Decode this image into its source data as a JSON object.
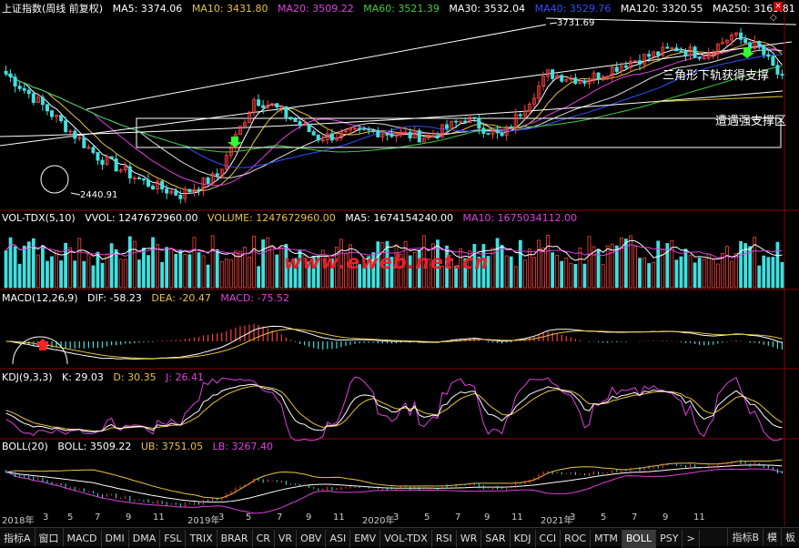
{
  "main": {
    "title": "上证指数(周线 前复权)",
    "ma": [
      {
        "label": "MA5: 3374.06",
        "color": "#ffffff"
      },
      {
        "label": "MA10: 3431.80",
        "color": "#e8c33c"
      },
      {
        "label": "MA20: 3509.22",
        "color": "#e040e0"
      },
      {
        "label": "MA60: 3521.39",
        "color": "#3ccf3c"
      },
      {
        "label": "MA30: 3532.04",
        "color": "#ffffff"
      },
      {
        "label": "MA40: 3529.76",
        "color": "#3050ff"
      },
      {
        "label": "MA120: 3320.55",
        "color": "#ffffff"
      },
      {
        "label": "MA250: 3163.81",
        "color": "#ffffff"
      }
    ],
    "high_label": "3731.69",
    "low_label": "2440.91",
    "annotation_1": "三角形下轨获得支撑",
    "annotation_2": "遭遇强支撑区",
    "watermark": "www.eweb.net.cn",
    "icons": {
      "close": "×",
      "diamond": "◇"
    }
  },
  "vol": {
    "title": "VOL-TDX(5,10)",
    "vvol": "VVOL: 1247672960.00",
    "volume": "VOLUME: 1247672960.00",
    "ma5": "MA5: 1674154240.00",
    "ma10": "MA10: 1675034112.00",
    "colors": {
      "vvol": "#ffffff",
      "volume": "#e8c33c",
      "ma5": "#ffffff",
      "ma10": "#e040e0"
    }
  },
  "macd": {
    "title": "MACD(12,26,9)",
    "dif": "DIF: -58.23",
    "dea": "DEA: -20.47",
    "macd": "MACD: -75.52",
    "colors": {
      "dif": "#ffffff",
      "dea": "#e8c33c",
      "macd": "#e040e0"
    }
  },
  "kdj": {
    "title": "KDJ(9,3,3)",
    "k": "K: 29.03",
    "d": "D: 30.35",
    "j": "J: 26.41",
    "colors": {
      "k": "#ffffff",
      "d": "#e8c33c",
      "j": "#e040e0"
    }
  },
  "boll": {
    "title": "BOLL(20)",
    "boll": "BOLL: 3509.22",
    "ub": "UB: 3751.05",
    "lb": "LB: 3267.40",
    "colors": {
      "boll": "#ffffff",
      "ub": "#e8c33c",
      "lb": "#e040e0"
    }
  },
  "xaxis": {
    "labels": [
      "2018年",
      "3",
      "5",
      "7",
      "9",
      "11",
      "2019年",
      "3",
      "5",
      "7",
      "9",
      "11",
      "2020年",
      "3",
      "5",
      "7",
      "9",
      "11",
      "2021年",
      "3",
      "5",
      "7",
      "9",
      "11",
      "3",
      "5",
      "7",
      "9",
      "11",
      "1",
      "3"
    ]
  },
  "tabs": [
    "指标A",
    "窗口",
    "MACD",
    "DMI",
    "DMA",
    "FSL",
    "TRIX",
    "BRAR",
    "CR",
    "VR",
    "OBV",
    "ASI",
    "EMV",
    "VOL-TDX",
    "RSI",
    "WR",
    "SAR",
    "KDJ",
    "CCI",
    "ROC",
    "MTM",
    "BOLL",
    "PSY"
  ],
  "active_tab": "BOLL",
  "tab_more": ">",
  "right_tools": [
    "指标B",
    "模",
    "板"
  ],
  "chart_data": {
    "type": "candlestick",
    "title": "上证指数(周线 前复权)",
    "high": 3731.69,
    "low": 2440.91,
    "ylim": [
      2350,
      3850
    ],
    "moving_averages": {
      "MA5": 3374.06,
      "MA10": 3431.8,
      "MA20": 3509.22,
      "MA60": 3521.39,
      "MA30": 3532.04,
      "MA40": 3529.76,
      "MA120": 3320.55,
      "MA250": 3163.81
    },
    "volume": {
      "VVOL": 1247672960.0,
      "VOLUME": 1247672960.0,
      "MA5": 1674154240.0,
      "MA10": 1675034112.0
    },
    "macd": {
      "DIF": -58.23,
      "DEA": -20.47,
      "MACD": -75.52
    },
    "kdj": {
      "K": 29.03,
      "D": 30.35,
      "J": 26.41
    },
    "boll": {
      "BOLL": 3509.22,
      "UB": 3751.05,
      "LB": 3267.4
    }
  }
}
